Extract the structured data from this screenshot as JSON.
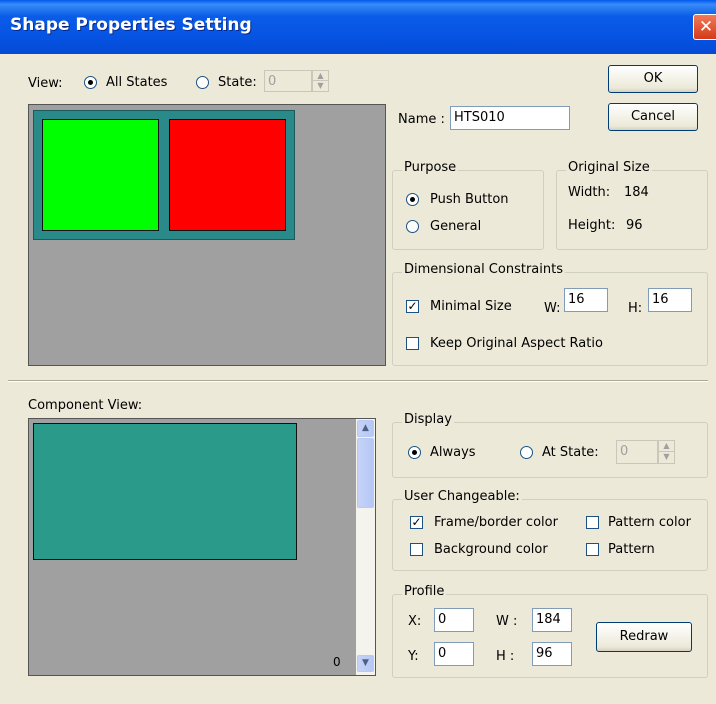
{
  "window": {
    "title": "Shape Properties Setting"
  },
  "view": {
    "label": "View:",
    "all_states_label": "All States",
    "state_label": "State:",
    "state_value": "0"
  },
  "buttons": {
    "ok": "OK",
    "cancel": "Cancel",
    "redraw": "Redraw"
  },
  "name": {
    "label": "Name :",
    "value": "HTS010"
  },
  "purpose": {
    "title": "Purpose",
    "options": [
      "Push Button",
      "General"
    ],
    "selected": "Push Button"
  },
  "original_size": {
    "title": "Original Size",
    "width_label": "Width:",
    "width_value": "184",
    "height_label": "Height:",
    "height_value": "96"
  },
  "dimensional_constraints": {
    "title": "Dimensional Constraints",
    "minimal_size_label": "Minimal Size",
    "minimal_size_checked": true,
    "w_label": "W:",
    "w_value": "16",
    "h_label": "H:",
    "h_value": "16",
    "keep_aspect_label": "Keep Original Aspect Ratio",
    "keep_aspect_checked": false
  },
  "preview": {
    "state_colors": [
      "#00ff00",
      "#ff0000"
    ],
    "frame_color": "#2a8a8a",
    "background_color": "#a0a0a0"
  },
  "component_view": {
    "label": "Component View:",
    "scroll_value": "0",
    "component_color": "#2a9a8a"
  },
  "display": {
    "title": "Display",
    "always_label": "Always",
    "at_state_label": "At State:",
    "at_state_value": "0",
    "selected": "Always"
  },
  "user_changeable": {
    "title": "User Changeable:",
    "frame_border_color_label": "Frame/border color",
    "frame_border_color_checked": true,
    "pattern_color_label": "Pattern color",
    "pattern_color_checked": false,
    "background_color_label": "Background color",
    "background_color_checked": false,
    "pattern_label": "Pattern",
    "pattern_checked": false
  },
  "profile": {
    "title": "Profile",
    "x_label": "X:",
    "x_value": "0",
    "y_label": "Y:",
    "y_value": "0",
    "w_label": "W :",
    "w_value": "184",
    "h_label": "H :",
    "h_value": "96"
  }
}
